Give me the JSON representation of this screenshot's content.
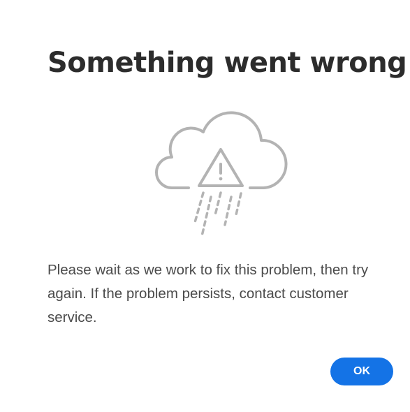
{
  "dialog": {
    "title": "Something went wrong",
    "illustration_icon": "cloud-rain-warning-icon",
    "message": "Please wait as we work to fix this problem, then try again. If the problem persists, contact customer service.",
    "ok_label": "OK"
  },
  "colors": {
    "title": "#2c2c2c",
    "body_text": "#4b4b4b",
    "illustration_stroke": "#b3b3b3",
    "button_bg": "#1473e6",
    "button_text": "#ffffff"
  }
}
